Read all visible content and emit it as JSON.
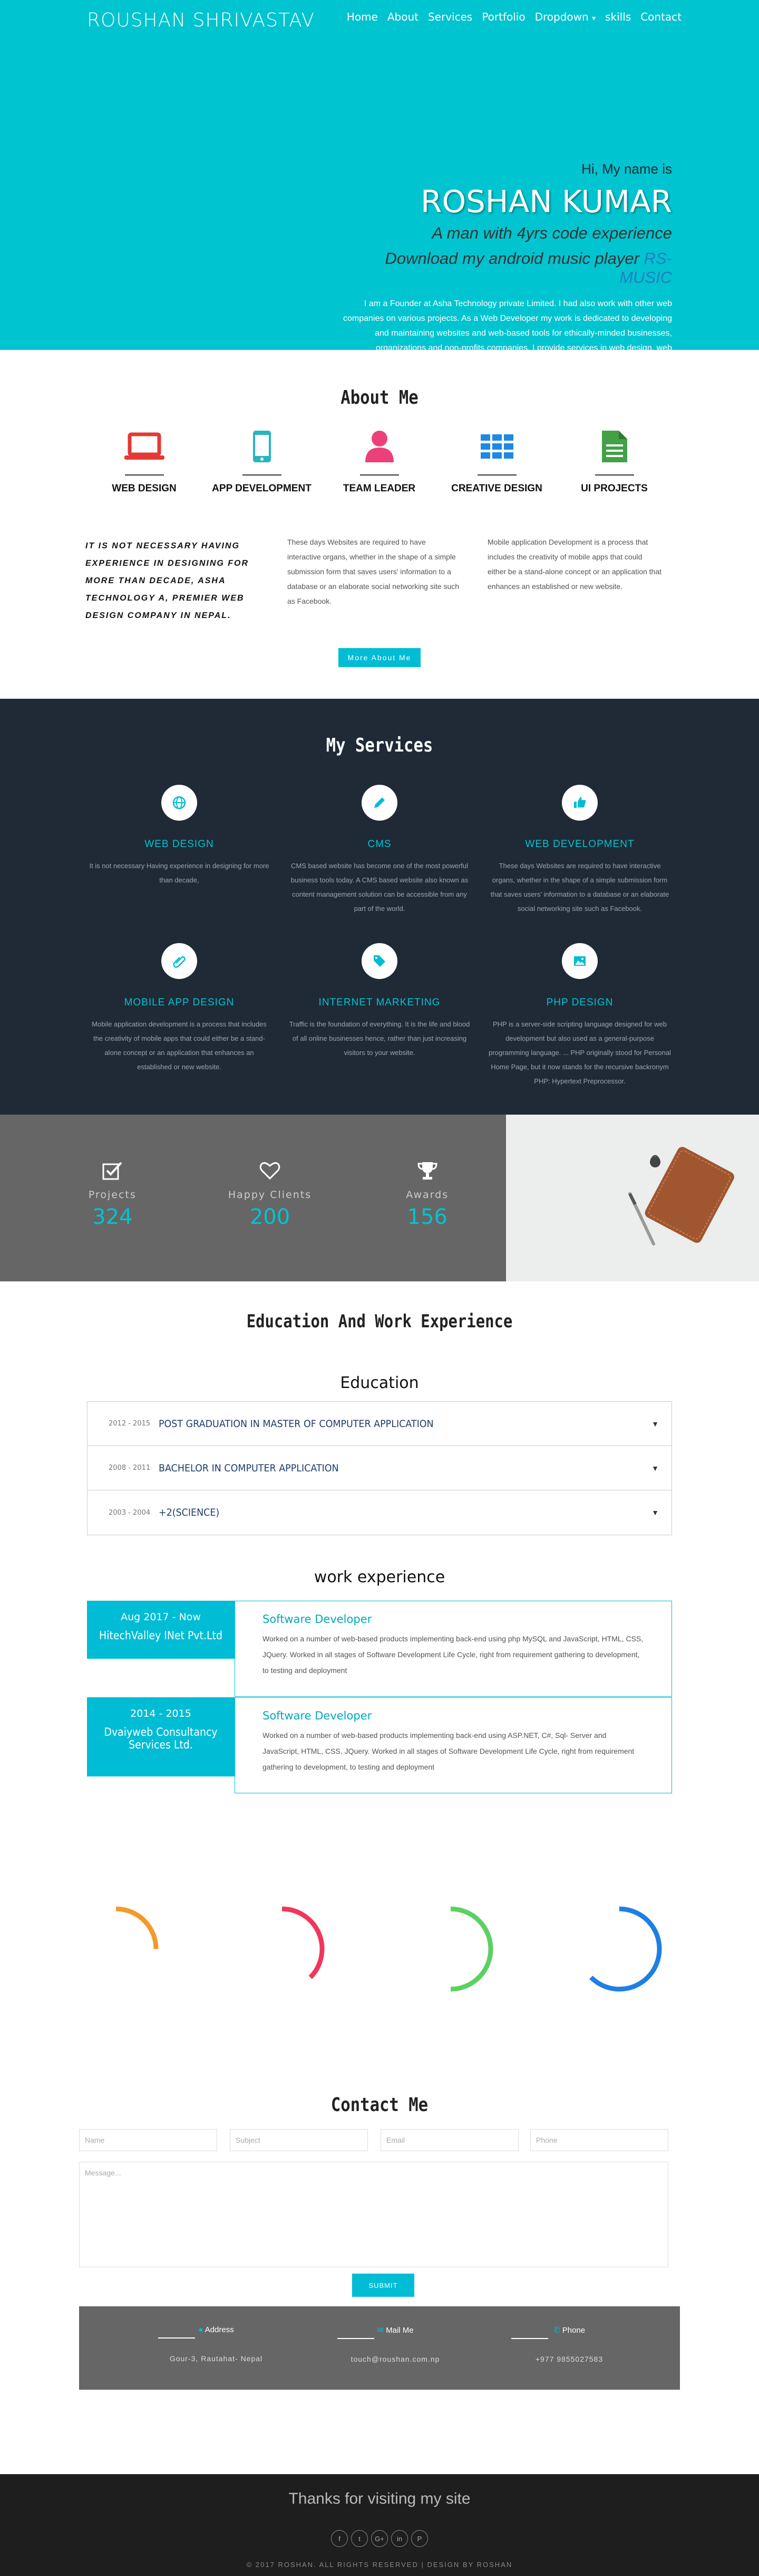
{
  "nav": {
    "brand": "ROUSHAN SHRIVASTAV",
    "items": [
      "Home",
      "About",
      "Services",
      "Portfolio",
      "Dropdown",
      "skills",
      "Contact"
    ],
    "dropdown_caret": "▾"
  },
  "hero": {
    "greeting": "Hi, My name is",
    "name": "ROSHAN KUMAR",
    "tagline": "A man with 4yrs code experience",
    "download_prefix": "Download my android music player",
    "download_link": "RS-MUSIC",
    "intro": "I am a Founder at Asha Technology private Limited. I had also work with other web companies on various projects. As a Web Developer my work is dedicated to developing and maintaining websites and web-based tools for ethically-minded businesses, organizations and non-profits companies. I provide services in web design, web development, database-driven application development & graphic design and SEO."
  },
  "about": {
    "title": "About Me",
    "items": [
      {
        "label": "WEB DESIGN",
        "icon": "laptop-icon",
        "color": "#e53935"
      },
      {
        "label": "APP DEVELOPMENT",
        "icon": "mobile-icon",
        "color": "#26b6c0"
      },
      {
        "label": "TEAM LEADER",
        "icon": "user-icon",
        "color": "#ec407a"
      },
      {
        "label": "CREATIVE DESIGN",
        "icon": "grid-icon",
        "color": "#1e88e5"
      },
      {
        "label": "UI PROJECTS",
        "icon": "document-icon",
        "color": "#43a047"
      }
    ],
    "quote": "IT IS NOT NECESSARY HAVING EXPERIENCE IN DESIGNING FOR MORE THAN DECADE, ASHA TECHNOLOGY A, PREMIER WEB DESIGN COMPANY IN NEPAL.",
    "para1": "These days Websites are required to have interactive organs, whether in the shape of a simple submission form that saves users' information to a database or an elaborate social networking site such as Facebook.",
    "para2": "Mobile application Development is a process that includes the creativity of mobile apps that could either be a stand-alone concept or an application that enhances an established or new website.",
    "button": "More About Me"
  },
  "services": {
    "title": "My Services",
    "items": [
      {
        "title": "WEB DESIGN",
        "icon": "globe-icon",
        "desc": "It is not necessary Having experience in designing for more than decade,"
      },
      {
        "title": "CMS",
        "icon": "pencil-icon",
        "desc": "CMS based website has become one of the most powerful business tools today. A CMS based website also known as content management solution can be accessible from any part of the world."
      },
      {
        "title": "WEB DEVELOPMENT",
        "icon": "thumbs-up-icon",
        "desc": "These days Websites are required to have interactive organs, whether in the shape of a simple submission form that saves users' information to a database or an elaborate social networking site such as Facebook."
      },
      {
        "title": "MOBILE APP DESIGN",
        "icon": "paperclip-icon",
        "desc": "Mobile application development is a process that includes the creativity of mobile apps that could either be a stand-alone concept or an application that enhances an established or new website."
      },
      {
        "title": "INTERNET MARKETING",
        "icon": "tag-icon",
        "desc": "Traffic is the foundation of everything. It is the life and blood of all online businesses hence, rather than just increasing visitors to your website."
      },
      {
        "title": "PHP DESIGN",
        "icon": "image-icon",
        "desc": "PHP is a server-side scripting language designed for web development but also used as a general-purpose programming language. ... PHP originally stood for Personal Home Page, but it now stands for the recursive backronym PHP: Hypertext Preprocessor."
      }
    ]
  },
  "stats": [
    {
      "label": "Projects",
      "value": "324",
      "icon": "checkbox-icon"
    },
    {
      "label": "Happy Clients",
      "value": "200",
      "icon": "heart-icon"
    },
    {
      "label": "Awards",
      "value": "156",
      "icon": "trophy-icon"
    }
  ],
  "education": {
    "title": "Education And Work Experience",
    "edu_heading": "Education",
    "rows": [
      {
        "years": "2012 - 2015",
        "title": "POST GRADUATION IN MASTER OF COMPUTER APPLICATION"
      },
      {
        "years": "2008 - 2011",
        "title": "BACHELOR IN COMPUTER APPLICATION"
      },
      {
        "years": "2003 - 2004",
        "title": "+2(SCIENCE)"
      }
    ],
    "work_heading": "work experience",
    "work": [
      {
        "date": "Aug 2017 - Now",
        "company": "HitechValley INet Pvt.Ltd",
        "role": "Software Developer",
        "desc": "Worked on a number of web-based products implementing back-end using php MySQL and JavaScript, HTML, CSS, JQuery. Worked in all stages of Software Development Life Cycle, right from requirement gathering to development, to testing and deployment"
      },
      {
        "date": "2014 - 2015",
        "company": "Dvaiyweb Consultancy Services Ltd.",
        "role": "Software Developer",
        "desc": "Worked on a number of web-based products implementing back-end using ASP.NET, C#, Sql- Server and JavaScript, HTML, CSS, JQuery. Worked in all stages of Software Development Life Cycle, right from requirement gathering to development, to testing and deployment"
      }
    ]
  },
  "skills": {
    "colors": [
      "#f39a2c",
      "#f0365c",
      "#5cd161",
      "#1e7fe5"
    ],
    "levels": [
      0.25,
      0.375,
      0.5,
      0.625
    ]
  },
  "contact": {
    "title": "Contact Me",
    "placeholders": {
      "name": "Name",
      "subject": "Subject",
      "email": "Email",
      "phone": "Phone",
      "message": "Message..."
    },
    "submit": "SUBMIT",
    "info": [
      {
        "heading": "Address",
        "value": "Gour-3, Rautahat- Nepal",
        "icon": "map-marker-icon"
      },
      {
        "heading": "Mail Me",
        "value": "touch@roushan.com.np",
        "icon": "envelope-icon"
      },
      {
        "heading": "Phone",
        "value": "+977 9855027583",
        "icon": "phone-icon"
      }
    ]
  },
  "footer": {
    "thanks": "Thanks for visiting my site",
    "socials": [
      "f",
      "t",
      "G+",
      "in",
      "P"
    ],
    "copyright": "© 2017 ROSHAN. ALL RIGHTS RESERVED | DESIGN BY ROSHAN"
  }
}
